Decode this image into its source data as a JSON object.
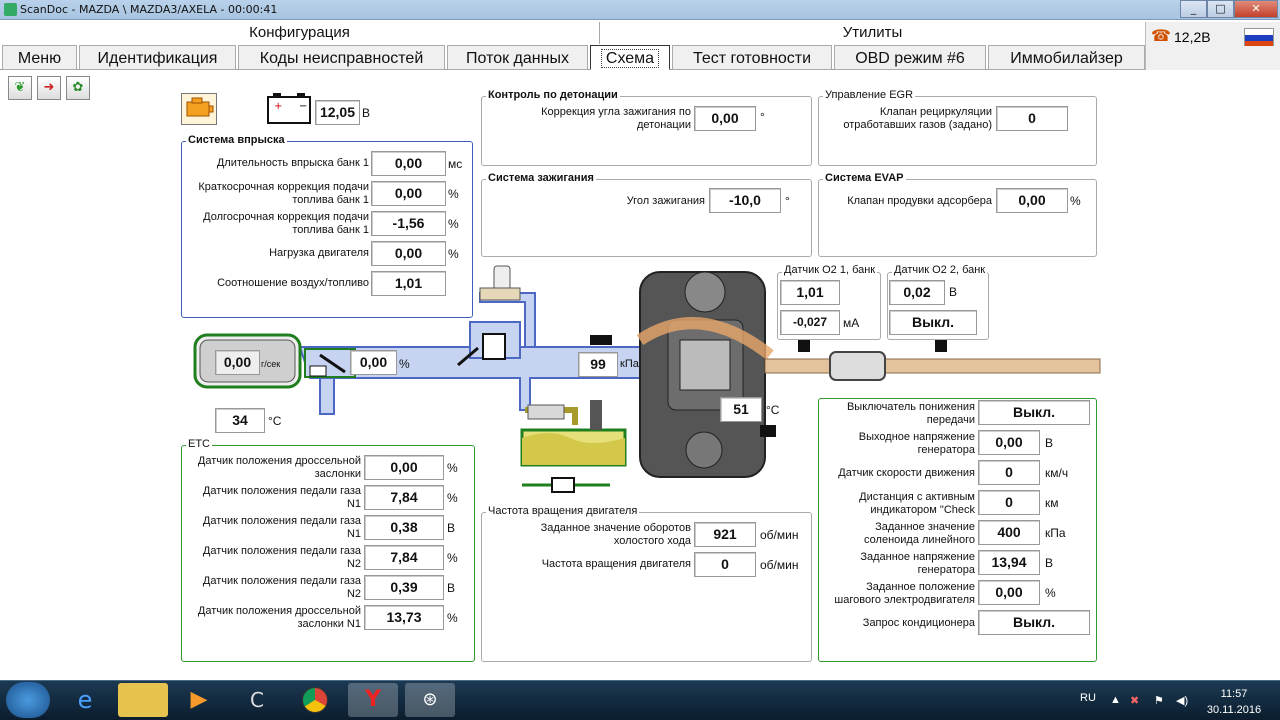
{
  "window": {
    "title": "ScanDoc - MAZDA \\ MAZDA3/AXELA - 00:00:41"
  },
  "sections": {
    "config": "Конфигурация",
    "utils": "Утилиты"
  },
  "status": {
    "voltage": "12,2В"
  },
  "tabs": [
    "Меню",
    "Идентификация",
    "Коды неисправностей",
    "Поток данных",
    "Схема",
    "Тест готовности",
    "OBD режим #6",
    "Иммобилайзер"
  ],
  "battery": {
    "value": "12,05",
    "unit": "В"
  },
  "injection": {
    "title": "Система впрыска",
    "rows": [
      {
        "label": "Длительность впрыска банк 1",
        "value": "0,00",
        "unit": "мс"
      },
      {
        "label": "Краткосрочная коррекция подачи топлива банк 1",
        "value": "0,00",
        "unit": "%"
      },
      {
        "label": "Долгосрочная коррекция подачи топлива банк 1",
        "value": "-1,56",
        "unit": "%"
      },
      {
        "label": "Нагрузка двигателя",
        "value": "0,00",
        "unit": "%"
      },
      {
        "label": "Соотношение воздух/топливо",
        "value": "1,01",
        "unit": ""
      }
    ]
  },
  "knock": {
    "title": "Контроль по детонации",
    "label": "Коррекция угла зажигания по детонации",
    "value": "0,00",
    "unit": "°"
  },
  "egr": {
    "title": "Управление EGR",
    "label": "Клапан рециркуляции отработавших газов (задано)",
    "value": "0"
  },
  "ignition": {
    "title": "Система зажигания",
    "label": "Угол зажигания",
    "value": "-10,0",
    "unit": "°"
  },
  "evap": {
    "title": "Система EVAP",
    "label": "Клапан продувки адсорбера",
    "value": "0,00",
    "unit": "%"
  },
  "o2_1": {
    "title": "Датчик O2 1, банк",
    "value": "1,01",
    "value2": "-0,027",
    "unit2": "мА"
  },
  "o2_2": {
    "title": "Датчик O2 2, банк",
    "value": "0,02",
    "unit": "В",
    "value2": "Выкл."
  },
  "maf": {
    "value": "0,00",
    "unit": "г/сек"
  },
  "throttle_pos": {
    "value": "0,00",
    "unit": "%"
  },
  "iat": {
    "value": "34",
    "unit": "°C"
  },
  "map": {
    "value": "99",
    "unit": "кПа"
  },
  "ect": {
    "value": "51",
    "unit": "°C"
  },
  "etc": {
    "title": "ETC",
    "rows": [
      {
        "label": "Датчик положения дроссельной заслонки",
        "value": "0,00",
        "unit": "%"
      },
      {
        "label": "Датчик положения педали газа N1",
        "value": "7,84",
        "unit": "%"
      },
      {
        "label": "Датчик положения педали газа N1",
        "value": "0,38",
        "unit": "В"
      },
      {
        "label": "Датчик положения педали газа N2",
        "value": "7,84",
        "unit": "%"
      },
      {
        "label": "Датчик положения педали газа N2",
        "value": "0,39",
        "unit": "В"
      },
      {
        "label": "Датчик положения дроссельной заслонки N1",
        "value": "13,73",
        "unit": "%"
      }
    ]
  },
  "rpm": {
    "title": "Частота вращения двигателя",
    "rows": [
      {
        "label": "Заданное значение оборотов холостого хода",
        "value": "921",
        "unit": "об/мин"
      },
      {
        "label": "Частота вращения двигателя",
        "value": "0",
        "unit": "об/мин"
      }
    ]
  },
  "misc": {
    "rows": [
      {
        "label": "Выключатель понижения передачи",
        "value": "Выкл.",
        "unit": ""
      },
      {
        "label": "Выходное напряжение генератора",
        "value": "0,00",
        "unit": "В"
      },
      {
        "label": "Датчик скорости движения",
        "value": "0",
        "unit": "км/ч"
      },
      {
        "label": "Дистанция с активным индикатором \"Check",
        "value": "0",
        "unit": "км"
      },
      {
        "label": "Заданное значение соленоида линейного",
        "value": "400",
        "unit": "кПа"
      },
      {
        "label": "Заданное напряжение генератора",
        "value": "13,94",
        "unit": "В"
      },
      {
        "label": "Заданное положение шагового электродвигателя",
        "value": "0,00",
        "unit": "%"
      },
      {
        "label": "Запрос кондиционера",
        "value": "Выкл.",
        "unit": ""
      }
    ]
  },
  "tray": {
    "lang": "RU",
    "time": "11:57",
    "date": "30.11.2016"
  }
}
